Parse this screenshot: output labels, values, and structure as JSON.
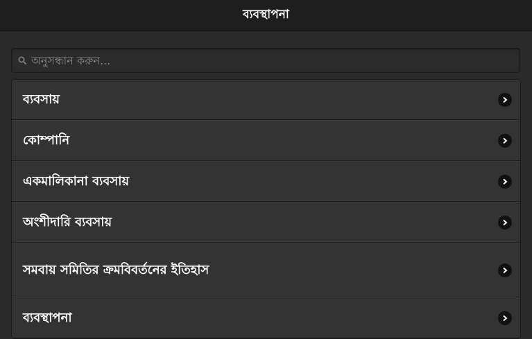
{
  "header": {
    "title": "ব্যবস্থাপনা"
  },
  "search": {
    "placeholder": "অনুসন্ধান করুন..."
  },
  "list": {
    "items": [
      {
        "label": "ব্যবসায়"
      },
      {
        "label": "কোম্পানি"
      },
      {
        "label": "একমালিকানা ব্যবসায়"
      },
      {
        "label": "অংশীদারি ব্যবসায়"
      },
      {
        "label": "সমবায় সমিতির ক্রমবিবর্তনের ইতিহাস"
      },
      {
        "label": "ব্যবস্থাপনা"
      }
    ]
  },
  "icons": {
    "search": "search-icon",
    "chevron": "chevron-right-icon"
  }
}
